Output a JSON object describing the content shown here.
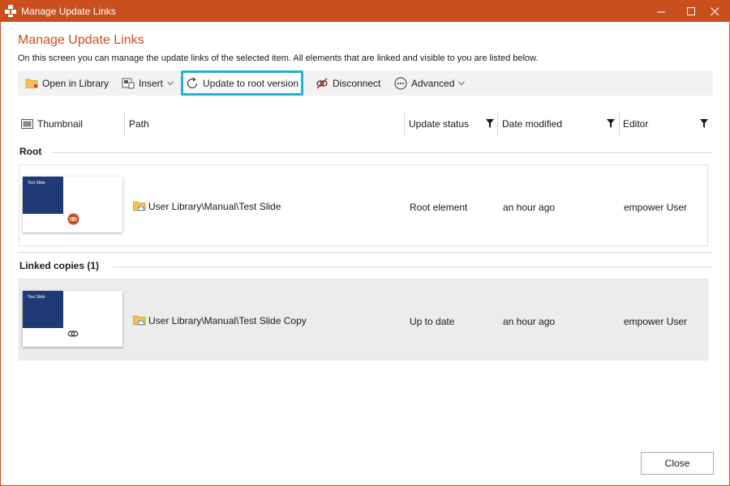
{
  "window": {
    "title": "Manage Update Links",
    "controls": {
      "minimize": "minimize-icon",
      "maximize": "maximize-icon",
      "close": "close-icon"
    }
  },
  "header": {
    "title": "Manage Update Links",
    "description": "On this screen you can manage the update links of the selected item. All elements that are linked and visible to you are listed below."
  },
  "toolbar": {
    "open_in_library": "Open in Library",
    "insert": "Insert",
    "update_to_root": "Update to root version",
    "disconnect": "Disconnect",
    "advanced": "Advanced"
  },
  "columns": {
    "thumbnail": "Thumbnail",
    "path": "Path",
    "update_status": "Update status",
    "date_modified": "Date modified",
    "editor": "Editor"
  },
  "groups": {
    "root": {
      "label": "Root",
      "item": {
        "thumb_text": "Test Slide",
        "path": "User Library\\Manual\\Test Slide",
        "update_status": "Root element",
        "date_modified": "an hour ago",
        "editor": "empower User"
      }
    },
    "linked": {
      "label": "Linked copies (1)",
      "item": {
        "thumb_text": "Test Slide",
        "path": "User Library\\Manual\\Test Slide Copy",
        "update_status": "Up to date",
        "date_modified": "an hour ago",
        "editor": "empower User"
      }
    }
  },
  "footer": {
    "close_label": "Close"
  },
  "colors": {
    "accent": "#c94f1f",
    "highlight": "#1fb3d6",
    "thumb_blue": "#1f3a75"
  }
}
